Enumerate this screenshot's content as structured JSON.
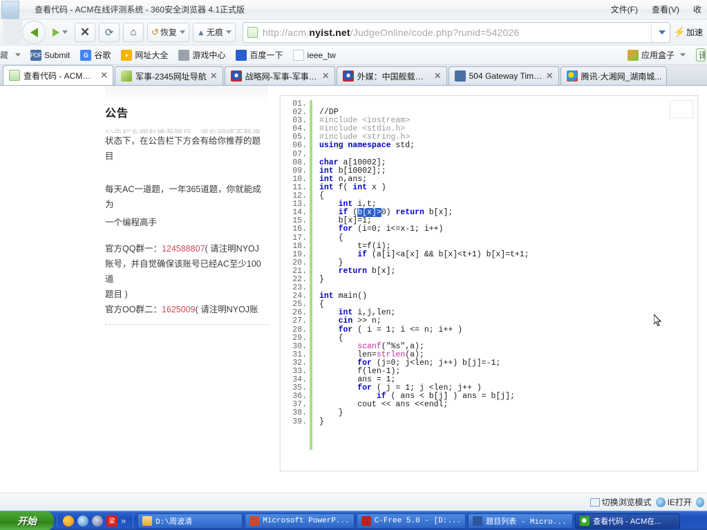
{
  "window": {
    "title": "查看代码 - ACM在线评测系统 - 360安全浏览器 4.1正式版",
    "app_icon": "browser-icon",
    "menus": [
      {
        "label": "文件(F)",
        "name": "menu-file"
      },
      {
        "label": "查看(V)",
        "name": "menu-view"
      },
      {
        "label": "收",
        "name": "menu-favorites"
      }
    ]
  },
  "toolbar": {
    "back": "back-arrow-icon",
    "forward": "forward-arrow-icon",
    "stop_label": "✕",
    "refresh_label": "⟳",
    "home_label": "⌂",
    "restore_label": "恢复",
    "incognito_label": "无痕",
    "accel_label": "加速"
  },
  "address": {
    "url_prefix": "http://acm.",
    "url_domain": "nyist.net",
    "url_suffix": "/JudgeOnline/code.php?runid=542026",
    "full_url": "http://acm.nyist.net/JudgeOnline/code.php?runid=542026",
    "favicon": "page-icon"
  },
  "bookmarks": {
    "left_clip": "藏",
    "items": [
      {
        "label": "Submit",
        "icon": "pdf-icon",
        "icon_text": "PDF"
      },
      {
        "label": "谷歌",
        "icon": "google-icon",
        "icon_text": "G"
      },
      {
        "label": "网址大全",
        "icon": "plus-circle-icon",
        "icon_text": "+"
      },
      {
        "label": "游戏中心",
        "icon": "gamepad-icon",
        "icon_text": ""
      },
      {
        "label": "百度一下",
        "icon": "baidu-icon",
        "icon_text": ""
      },
      {
        "label": "ieee_tw",
        "icon": "document-icon",
        "icon_text": ""
      }
    ],
    "appbox_label": "应用盒子",
    "translate_label": "译"
  },
  "tabs": [
    {
      "label": "查看代码 - ACM在线...",
      "favicon": "acm-icon",
      "active": true,
      "close": "✕"
    },
    {
      "label": "军事-2345网址导航",
      "favicon": "site2345-icon",
      "active": false,
      "close": "✕"
    },
    {
      "label": "战略网-军事-军事新...",
      "favicon": "strategy-icon",
      "active": false,
      "close": "✕"
    },
    {
      "label": "外媒：中国舰载战机...",
      "favicon": "news-icon",
      "active": false,
      "close": "✕"
    },
    {
      "label": "504 Gateway Time-...",
      "favicon": "pdf-icon",
      "active": false,
      "close": "✕"
    },
    {
      "label": "腾讯·大湘网_湖南城...",
      "favicon": "qq-icon",
      "active": false,
      "close": "✕"
    }
  ],
  "announcement": {
    "title": "公告",
    "faded_line": "公告栏右侧有推荐题目，求在网络不登录",
    "line1": "状态下，在公告栏下方会有给你推荐的题目",
    "line2": "每天AC一道题，一年365道题，你就能成为",
    "line3": "一个编程高手",
    "qq1_label": "官方QQ群一：",
    "qq1_number": "124588807",
    "qq1_tail": "( 请注明NYOJ",
    "qq1_line2": "账号，并自觉确保该账号已经AC至少100道",
    "qq1_line3": "题目 )",
    "qq2_label": "官方OO群二：",
    "qq2_number": "1625009",
    "qq2_tail": "( 请注明NYOJ账"
  },
  "code": {
    "top_faint": "...",
    "gutter_suffix": ".",
    "lines": [
      {
        "n": "01",
        "tokens": [
          {
            "t": "",
            "c": ""
          }
        ]
      },
      {
        "n": "02",
        "tokens": [
          {
            "t": "//DP",
            "c": "cm"
          }
        ]
      },
      {
        "n": "03",
        "tokens": [
          {
            "t": "#include <iostream>",
            "c": "pp"
          }
        ]
      },
      {
        "n": "04",
        "tokens": [
          {
            "t": "#include <stdio.h>",
            "c": "pp"
          }
        ]
      },
      {
        "n": "05",
        "tokens": [
          {
            "t": "#include <string.h>",
            "c": "pp"
          }
        ]
      },
      {
        "n": "06",
        "tokens": [
          {
            "t": "using namespace ",
            "c": "kw"
          },
          {
            "t": "std;",
            "c": ""
          }
        ]
      },
      {
        "n": "07",
        "tokens": [
          {
            "t": "",
            "c": ""
          }
        ]
      },
      {
        "n": "08",
        "tokens": [
          {
            "t": "char ",
            "c": "kw"
          },
          {
            "t": "a[10002];",
            "c": ""
          }
        ]
      },
      {
        "n": "09",
        "tokens": [
          {
            "t": "int ",
            "c": "kw"
          },
          {
            "t": "b[10002];;",
            "c": ""
          }
        ]
      },
      {
        "n": "10",
        "tokens": [
          {
            "t": "int ",
            "c": "kw"
          },
          {
            "t": "n,ans;",
            "c": ""
          }
        ]
      },
      {
        "n": "11",
        "tokens": [
          {
            "t": "int ",
            "c": "kw"
          },
          {
            "t": "f( ",
            "c": ""
          },
          {
            "t": "int ",
            "c": "kw"
          },
          {
            "t": "x )",
            "c": ""
          }
        ]
      },
      {
        "n": "12",
        "tokens": [
          {
            "t": "{",
            "c": ""
          }
        ]
      },
      {
        "n": "13",
        "tokens": [
          {
            "t": "    ",
            "c": ""
          },
          {
            "t": "int ",
            "c": "kw"
          },
          {
            "t": "i,t;",
            "c": ""
          }
        ]
      },
      {
        "n": "14",
        "tokens": [
          {
            "t": "    ",
            "c": ""
          },
          {
            "t": "if ",
            "c": "kw"
          },
          {
            "t": "(",
            "c": ""
          },
          {
            "t": "b[x]>",
            "c": "sel"
          },
          {
            "t": "0) ",
            "c": ""
          },
          {
            "t": "return ",
            "c": "kw"
          },
          {
            "t": "b[x];",
            "c": ""
          }
        ]
      },
      {
        "n": "15",
        "tokens": [
          {
            "t": "    b[x]=1;",
            "c": ""
          }
        ]
      },
      {
        "n": "16",
        "tokens": [
          {
            "t": "    ",
            "c": ""
          },
          {
            "t": "for ",
            "c": "kw"
          },
          {
            "t": "(i=0; i<=x-1; i++)",
            "c": ""
          }
        ]
      },
      {
        "n": "17",
        "tokens": [
          {
            "t": "    {",
            "c": ""
          }
        ]
      },
      {
        "n": "18",
        "tokens": [
          {
            "t": "        t=f(i);",
            "c": ""
          }
        ]
      },
      {
        "n": "19",
        "tokens": [
          {
            "t": "        ",
            "c": ""
          },
          {
            "t": "if ",
            "c": "kw"
          },
          {
            "t": "(a[i]<a[x] && b[x]<t+1) b[x]=t+1;",
            "c": ""
          }
        ]
      },
      {
        "n": "20",
        "tokens": [
          {
            "t": "    }",
            "c": ""
          }
        ]
      },
      {
        "n": "21",
        "tokens": [
          {
            "t": "    ",
            "c": ""
          },
          {
            "t": "return ",
            "c": "kw"
          },
          {
            "t": "b[x];",
            "c": ""
          }
        ]
      },
      {
        "n": "22",
        "tokens": [
          {
            "t": "}",
            "c": ""
          }
        ]
      },
      {
        "n": "23",
        "tokens": [
          {
            "t": "",
            "c": ""
          }
        ]
      },
      {
        "n": "24",
        "tokens": [
          {
            "t": "int ",
            "c": "kw"
          },
          {
            "t": "main()",
            "c": ""
          }
        ]
      },
      {
        "n": "25",
        "tokens": [
          {
            "t": "{",
            "c": ""
          }
        ]
      },
      {
        "n": "26",
        "tokens": [
          {
            "t": "    ",
            "c": ""
          },
          {
            "t": "int ",
            "c": "kw"
          },
          {
            "t": "i,j,len;",
            "c": ""
          }
        ]
      },
      {
        "n": "27",
        "tokens": [
          {
            "t": "    ",
            "c": ""
          },
          {
            "t": "cin ",
            "c": "kw"
          },
          {
            "t": ">> n;",
            "c": ""
          }
        ]
      },
      {
        "n": "28",
        "tokens": [
          {
            "t": "    ",
            "c": ""
          },
          {
            "t": "for ",
            "c": "kw"
          },
          {
            "t": "( i = 1; i <= n; i++ )",
            "c": ""
          }
        ]
      },
      {
        "n": "29",
        "tokens": [
          {
            "t": "    {",
            "c": ""
          }
        ]
      },
      {
        "n": "30",
        "tokens": [
          {
            "t": "        ",
            "c": ""
          },
          {
            "t": "scanf",
            "c": "fn"
          },
          {
            "t": "(\"%s\",a);",
            "c": ""
          }
        ]
      },
      {
        "n": "31",
        "tokens": [
          {
            "t": "        len=",
            "c": ""
          },
          {
            "t": "strlen",
            "c": "fn"
          },
          {
            "t": "(a);",
            "c": ""
          }
        ]
      },
      {
        "n": "32",
        "tokens": [
          {
            "t": "        ",
            "c": ""
          },
          {
            "t": "for ",
            "c": "kw"
          },
          {
            "t": "(j=0; j<len; j++) b[j]=-1;",
            "c": ""
          }
        ]
      },
      {
        "n": "33",
        "tokens": [
          {
            "t": "        f(len-1);",
            "c": ""
          }
        ]
      },
      {
        "n": "34",
        "tokens": [
          {
            "t": "        ans = 1;",
            "c": ""
          }
        ]
      },
      {
        "n": "35",
        "tokens": [
          {
            "t": "        ",
            "c": ""
          },
          {
            "t": "for ",
            "c": "kw"
          },
          {
            "t": "( j = 1; j <len; j++ )",
            "c": ""
          }
        ]
      },
      {
        "n": "36",
        "tokens": [
          {
            "t": "            ",
            "c": ""
          },
          {
            "t": "if ",
            "c": "kw"
          },
          {
            "t": "( ans < b[j] ) ans = b[j];",
            "c": ""
          }
        ]
      },
      {
        "n": "37",
        "tokens": [
          {
            "t": "        cout << ans <<endl;",
            "c": ""
          }
        ]
      },
      {
        "n": "38",
        "tokens": [
          {
            "t": "    }",
            "c": ""
          }
        ]
      },
      {
        "n": "39",
        "tokens": [
          {
            "t": "}",
            "c": ""
          }
        ]
      }
    ]
  },
  "statusbar": {
    "switch_mode_label": "切换浏览模式",
    "ie_open_label": "IE打开"
  },
  "taskbar": {
    "start_label": "开始",
    "quicklaunch": [
      {
        "name": "media-player-icon"
      },
      {
        "name": "ie-icon"
      },
      {
        "name": "explorer-icon"
      },
      {
        "name": "ime-icon",
        "text": "梁"
      }
    ],
    "more_label": "»",
    "items": [
      {
        "label": "D:\\周波清",
        "icon": "folder-icon",
        "active": false
      },
      {
        "label": "Microsoft PowerP...",
        "icon": "powerpoint-icon",
        "active": false
      },
      {
        "label": "C-Free 5.0 - [D:...",
        "icon": "cfree-icon",
        "active": false
      },
      {
        "label": "题目列表 - Micro...",
        "icon": "word-icon",
        "active": false
      },
      {
        "label": "查看代码 - ACM在...",
        "icon": "browser-360-icon",
        "active": true
      }
    ]
  },
  "colors": {
    "accent_green": "#5aa425",
    "selection_blue": "#2a5fc8",
    "keyword_blue": "#0000c8",
    "function_magenta": "#c2289a",
    "taskbar_blue": "#1d4fba",
    "qq_red": "#d04a5a"
  }
}
